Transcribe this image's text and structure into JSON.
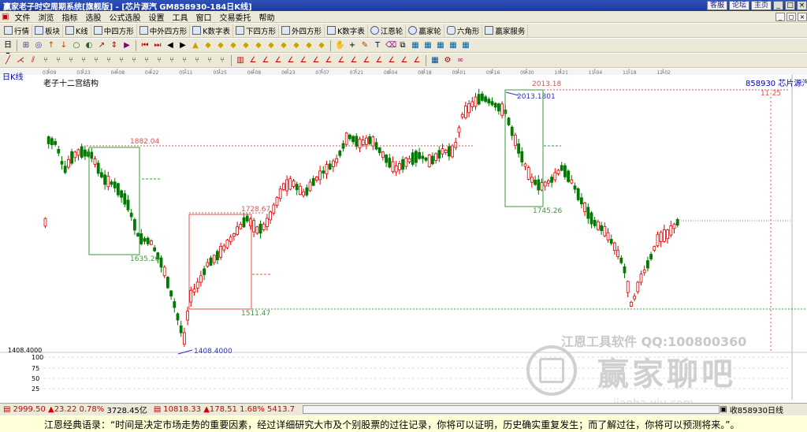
{
  "window": {
    "title": "赢家老子时空周期系统[旗舰版] - [芯片源汽  GM858930-184日K线]",
    "links": [
      "客服",
      "论坛",
      "主页"
    ]
  },
  "menu": [
    "文件",
    "浏览",
    "指标",
    "选股",
    "公式选股",
    "设置",
    "工具",
    "窗口",
    "交易委托",
    "帮助"
  ],
  "toolbar1": [
    "行情",
    "板块",
    "K线",
    "中四方形",
    "中外四方形",
    "K数字表",
    "下四方形",
    "外四方形",
    "K数字表",
    "江恩轮",
    "赢家轮",
    "六角形",
    "赢家服务"
  ],
  "chart": {
    "period_label": "日K线",
    "indicator_label": "老子十二宫结构",
    "symbol_label": "858930 芯片源汽",
    "date_ticks": [
      "03-09",
      "03-23",
      "04-08",
      "04-22",
      "05-11",
      "05-25",
      "06-08",
      "06-23",
      "07-07",
      "07-21",
      "08-04",
      "08-18",
      "09-01",
      "09-16",
      "09-30",
      "10-21",
      "11-04",
      "11-18",
      "12-02"
    ],
    "y_axis_price_label": "1408.4000",
    "lower_scale_labels": [
      "100",
      "75",
      "50",
      "25"
    ],
    "annotations": {
      "high_marker": "2013.18",
      "high_date": "11-25",
      "box1_top": "1882.04",
      "box1_bottom": "1635.26",
      "low_point": "1408.4000",
      "box2_top": "1728.67",
      "box2_bottom": "1511.47",
      "box3_top": "2013.1801",
      "box3_bottom": "1745.26"
    },
    "colors": {
      "up": "#e00000",
      "down": "#007a00",
      "box_green": "#3a9a3a",
      "box_red": "#e05050",
      "low_line": "#3030c0"
    }
  },
  "watermark": {
    "tools": "江恩工具软件  QQ:100800360",
    "big_text": "赢家聊吧",
    "url": "jiaoba.yiu.com"
  },
  "status": {
    "index1_value": "2999.50",
    "index1_change": "▲23.22",
    "index1_pct": "0.78%",
    "index1_amount": "3728.45亿",
    "index2_value": "10818.33",
    "index2_change": "▲178.51",
    "index2_pct": "1.68%",
    "index2_amount": "5413.7",
    "right_label": "收858930日线"
  },
  "quote": "江恩经典语录：“时间是决定市场走势的重要因素，经过详细研究大市及个别股票的过往记录，你将可以证明，历史确实重复发生；而了解过往，你将可以预测将来。”。"
}
